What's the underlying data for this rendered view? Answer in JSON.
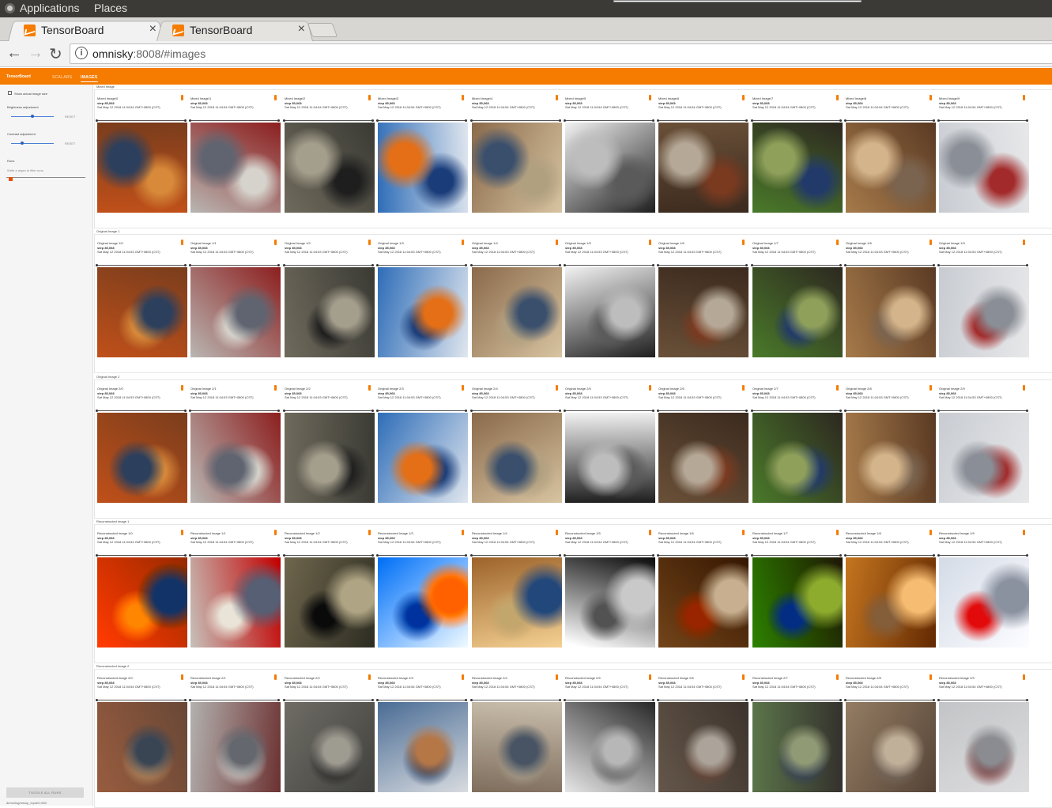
{
  "os_panel": {
    "applications": "Applications",
    "places": "Places"
  },
  "browser": {
    "tabs": [
      {
        "title": "TensorBoard",
        "close": "×",
        "active": true
      },
      {
        "title": "TensorBoard",
        "close": "×",
        "active": false
      }
    ],
    "nav": {
      "back": "←",
      "forward": "→",
      "reload": "↻",
      "info": "i"
    },
    "url_host": "omnisky",
    "url_rest": ":8008/#images"
  },
  "tensorboard": {
    "brand": "TensorBoard",
    "tabs": [
      "SCALARS",
      "IMAGES"
    ],
    "active_tab": "IMAGES",
    "accent": "#f57c00"
  },
  "sidebar": {
    "show_actual_size": "Show actual image size",
    "brightness_label": "Brightness adjustment",
    "brightness_reset": "RESET",
    "brightness_value": 0.5,
    "contrast_label": "Contrast adjustment",
    "contrast_reset": "RESET",
    "contrast_value": 0.25,
    "runs_label": "Runs",
    "filter_placeholder": "Write a regex to filter runs",
    "run_checked": true,
    "toggle_all": "TOGGLE ALL RUNS",
    "run_path": "demo/log/mixup_input/0.002/"
  },
  "sections": [
    {
      "title": "Mixed Image",
      "cards": [
        {
          "title": "Mixed Image/0",
          "step": "step 85,068",
          "time": "Sat May 12 2018 11:04:54 GMT+0800 (CST)"
        },
        {
          "title": "Mixed Image/1",
          "step": "step 85,068",
          "time": "Sat May 12 2018 11:04:54 GMT+0800 (CST)"
        },
        {
          "title": "Mixed Image/2",
          "step": "step 85,068",
          "time": "Sat May 12 2018 11:04:54 GMT+0800 (CST)"
        },
        {
          "title": "Mixed Image/3",
          "step": "step 85,068",
          "time": "Sat May 12 2018 11:04:54 GMT+0800 (CST)"
        },
        {
          "title": "Mixed Image/4",
          "step": "step 85,068",
          "time": "Sat May 12 2018 11:04:54 GMT+0800 (CST)"
        },
        {
          "title": "Mixed Image/5",
          "step": "step 85,068",
          "time": "Sat May 12 2018 11:04:54 GMT+0800 (CST)"
        },
        {
          "title": "Mixed Image/6",
          "step": "step 85,068",
          "time": "Sat May 12 2018 11:04:54 GMT+0800 (CST)"
        },
        {
          "title": "Mixed Image/7",
          "step": "step 85,068",
          "time": "Sat May 12 2018 11:04:54 GMT+0800 (CST)"
        },
        {
          "title": "Mixed Image/8",
          "step": "step 85,068",
          "time": "Sat May 12 2018 11:04:54 GMT+0800 (CST)"
        },
        {
          "title": "Mixed Image/9",
          "step": "step 85,068",
          "time": "Sat May 12 2018 11:04:54 GMT+0800 (CST)"
        }
      ]
    },
    {
      "title": "Original Image 1",
      "cards": [
        {
          "title": "Original Image 1/0",
          "step": "step 85,068",
          "time": "Sat May 12 2018 11:04:53 GMT+0800 (CST)"
        },
        {
          "title": "Original Image 1/1",
          "step": "step 85,068",
          "time": "Sat May 12 2018 11:04:53 GMT+0800 (CST)"
        },
        {
          "title": "Original Image 1/2",
          "step": "step 85,068",
          "time": "Sat May 12 2018 11:04:53 GMT+0800 (CST)"
        },
        {
          "title": "Original Image 1/3",
          "step": "step 85,068",
          "time": "Sat May 12 2018 11:04:53 GMT+0800 (CST)"
        },
        {
          "title": "Original Image 1/4",
          "step": "step 85,068",
          "time": "Sat May 12 2018 11:04:53 GMT+0800 (CST)"
        },
        {
          "title": "Original Image 1/5",
          "step": "step 85,068",
          "time": "Sat May 12 2018 11:04:53 GMT+0800 (CST)"
        },
        {
          "title": "Original Image 1/6",
          "step": "step 85,068",
          "time": "Sat May 12 2018 11:04:53 GMT+0800 (CST)"
        },
        {
          "title": "Original Image 1/7",
          "step": "step 85,068",
          "time": "Sat May 12 2018 11:04:53 GMT+0800 (CST)"
        },
        {
          "title": "Original Image 1/8",
          "step": "step 85,068",
          "time": "Sat May 12 2018 11:04:53 GMT+0800 (CST)"
        },
        {
          "title": "Original Image 1/9",
          "step": "step 85,068",
          "time": "Sat May 12 2018 11:04:53 GMT+0800 (CST)"
        }
      ]
    },
    {
      "title": "Original Image 2",
      "cards": [
        {
          "title": "Original Image 2/0",
          "step": "step 85,068",
          "time": "Sat May 12 2018 11:04:53 GMT+0800 (CST)"
        },
        {
          "title": "Original Image 2/1",
          "step": "step 85,068",
          "time": "Sat May 12 2018 11:04:53 GMT+0800 (CST)"
        },
        {
          "title": "Original Image 2/2",
          "step": "step 85,068",
          "time": "Sat May 12 2018 11:04:53 GMT+0800 (CST)"
        },
        {
          "title": "Original Image 2/3",
          "step": "step 85,068",
          "time": "Sat May 12 2018 11:04:53 GMT+0800 (CST)"
        },
        {
          "title": "Original Image 2/4",
          "step": "step 85,068",
          "time": "Sat May 12 2018 11:04:53 GMT+0800 (CST)"
        },
        {
          "title": "Original Image 2/5",
          "step": "step 85,068",
          "time": "Sat May 12 2018 11:04:53 GMT+0800 (CST)"
        },
        {
          "title": "Original Image 2/6",
          "step": "step 85,068",
          "time": "Sat May 12 2018 11:04:53 GMT+0800 (CST)"
        },
        {
          "title": "Original Image 2/7",
          "step": "step 85,068",
          "time": "Sat May 12 2018 11:04:53 GMT+0800 (CST)"
        },
        {
          "title": "Original Image 2/8",
          "step": "step 85,068",
          "time": "Sat May 12 2018 11:04:53 GMT+0800 (CST)"
        },
        {
          "title": "Original Image 2/9",
          "step": "step 85,068",
          "time": "Sat May 12 2018 11:04:53 GMT+0800 (CST)"
        }
      ]
    },
    {
      "title": "Reconstructed Image 1",
      "cards": [
        {
          "title": "Reconstructed Image 1/0",
          "step": "step 85,068",
          "time": "Sat May 12 2018 11:04:54 GMT+0800 (CST)"
        },
        {
          "title": "Reconstructed Image 1/1",
          "step": "step 85,068",
          "time": "Sat May 12 2018 11:04:54 GMT+0800 (CST)"
        },
        {
          "title": "Reconstructed Image 1/2",
          "step": "step 85,068",
          "time": "Sat May 12 2018 11:04:54 GMT+0800 (CST)"
        },
        {
          "title": "Reconstructed Image 1/3",
          "step": "step 85,068",
          "time": "Sat May 12 2018 11:04:54 GMT+0800 (CST)"
        },
        {
          "title": "Reconstructed Image 1/4",
          "step": "step 85,068",
          "time": "Sat May 12 2018 11:04:54 GMT+0800 (CST)"
        },
        {
          "title": "Reconstructed Image 1/5",
          "step": "step 85,068",
          "time": "Sat May 12 2018 11:04:54 GMT+0800 (CST)"
        },
        {
          "title": "Reconstructed Image 1/6",
          "step": "step 85,068",
          "time": "Sat May 12 2018 11:04:54 GMT+0800 (CST)"
        },
        {
          "title": "Reconstructed Image 1/7",
          "step": "step 85,068",
          "time": "Sat May 12 2018 11:04:54 GMT+0800 (CST)"
        },
        {
          "title": "Reconstructed Image 1/8",
          "step": "step 85,068",
          "time": "Sat May 12 2018 11:04:54 GMT+0800 (CST)"
        },
        {
          "title": "Reconstructed Image 1/9",
          "step": "step 85,068",
          "time": "Sat May 12 2018 11:04:54 GMT+0800 (CST)"
        }
      ]
    },
    {
      "title": "Reconstructed Image 2",
      "cards": [
        {
          "title": "Reconstructed Image 2/0",
          "step": "step 85,068",
          "time": "Sat May 12 2018 11:04:54 GMT+0800 (CST)"
        },
        {
          "title": "Reconstructed Image 2/1",
          "step": "step 85,068",
          "time": "Sat May 12 2018 11:04:54 GMT+0800 (CST)"
        },
        {
          "title": "Reconstructed Image 2/2",
          "step": "step 85,068",
          "time": "Sat May 12 2018 11:04:54 GMT+0800 (CST)"
        },
        {
          "title": "Reconstructed Image 2/3",
          "step": "step 85,068",
          "time": "Sat May 12 2018 11:04:54 GMT+0800 (CST)"
        },
        {
          "title": "Reconstructed Image 2/4",
          "step": "step 85,068",
          "time": "Sat May 12 2018 11:04:54 GMT+0800 (CST)"
        },
        {
          "title": "Reconstructed Image 2/5",
          "step": "step 85,068",
          "time": "Sat May 12 2018 11:04:54 GMT+0800 (CST)"
        },
        {
          "title": "Reconstructed Image 2/6",
          "step": "step 85,068",
          "time": "Sat May 12 2018 11:04:54 GMT+0800 (CST)"
        },
        {
          "title": "Reconstructed Image 2/7",
          "step": "step 85,068",
          "time": "Sat May 12 2018 11:04:54 GMT+0800 (CST)"
        },
        {
          "title": "Reconstructed Image 2/8",
          "step": "step 85,068",
          "time": "Sat May 12 2018 11:04:54 GMT+0800 (CST)"
        },
        {
          "title": "Reconstructed Image 2/9",
          "step": "step 85,068",
          "time": "Sat May 12 2018 11:04:54 GMT+0800 (CST)"
        }
      ]
    }
  ],
  "image_palettes": [
    [
      "#c0501a",
      "#7a3d1c",
      "#2c3f5c",
      "#d88a3a"
    ],
    [
      "#b9b6b2",
      "#8c1f1f",
      "#5f6470",
      "#d6d3cc"
    ],
    [
      "#6f6a5c",
      "#3a3a34",
      "#a49e8c",
      "#1e1e1e"
    ],
    [
      "#2e6db8",
      "#e0e6ee",
      "#e46f16",
      "#1a3d7a"
    ],
    [
      "#8a6a4a",
      "#d8c4a2",
      "#3a4f6c",
      "#b0a080"
    ],
    [
      "#f2f2f2",
      "#1e1e1e",
      "#bdbdbd",
      "#5a5a5a"
    ],
    [
      "#6a5038",
      "#3b2a1e",
      "#b5a896",
      "#7a3a20"
    ],
    [
      "#4a7a2a",
      "#2d2820",
      "#8fa05a",
      "#223a6a"
    ],
    [
      "#a67a4a",
      "#5a3a24",
      "#d4b48a",
      "#7a6450"
    ],
    [
      "#c8ccd2",
      "#e8e8ea",
      "#8a8e96",
      "#a22a2a"
    ]
  ]
}
